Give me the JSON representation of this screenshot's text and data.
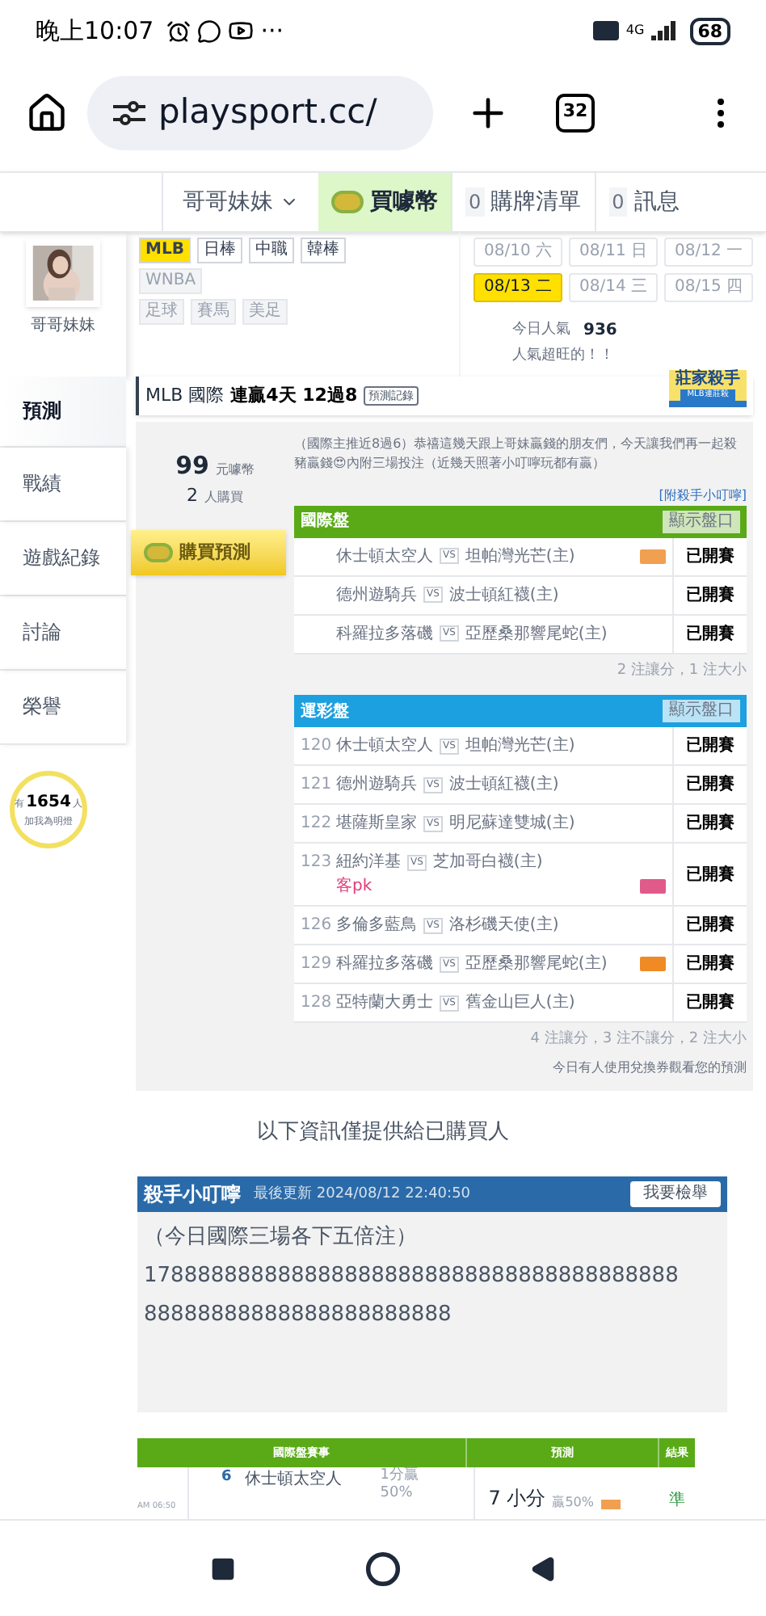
{
  "status_bar": {
    "time": "晚上10:07",
    "more": "···",
    "network": "4G",
    "battery": "68"
  },
  "browser": {
    "url": "playsport.cc/",
    "tab_count": "32"
  },
  "site_nav": {
    "user": "哥哥妹妹",
    "buy_coins": "買噱幣",
    "cart_count": "0",
    "cart": "購牌清單",
    "msg_count": "0",
    "messages": "訊息"
  },
  "profile": {
    "name": "哥哥妹妹"
  },
  "sports": [
    {
      "label": "MLB",
      "selected": true,
      "disabled": false
    },
    {
      "label": "日棒",
      "selected": false,
      "disabled": false
    },
    {
      "label": "中職",
      "selected": false,
      "disabled": false
    },
    {
      "label": "韓棒",
      "selected": false,
      "disabled": false
    },
    {
      "label": "WNBA",
      "selected": false,
      "disabled": true
    },
    {
      "label": "足球",
      "selected": false,
      "disabled": true
    },
    {
      "label": "賽馬",
      "selected": false,
      "disabled": true
    },
    {
      "label": "美足",
      "selected": false,
      "disabled": true
    }
  ],
  "dates": [
    {
      "date": "08/10",
      "day": "六",
      "selected": false
    },
    {
      "date": "08/11",
      "day": "日",
      "selected": false
    },
    {
      "date": "08/12",
      "day": "一",
      "selected": false
    },
    {
      "date": "08/13",
      "day": "二",
      "selected": true
    },
    {
      "date": "08/14",
      "day": "三",
      "selected": false
    },
    {
      "date": "08/15",
      "day": "四",
      "selected": false
    }
  ],
  "popularity": {
    "label": "今日人氣",
    "value": "936",
    "note": "人氣超旺的！！"
  },
  "sidebar": {
    "items": [
      {
        "label": "預測",
        "selected": true
      },
      {
        "label": "戰績",
        "selected": false
      },
      {
        "label": "遊戲紀錄",
        "selected": false
      },
      {
        "label": "討論",
        "selected": false
      },
      {
        "label": "榮譽",
        "selected": false
      }
    ],
    "fans_prefix": "有",
    "fans": "1654",
    "fans_suffix": "人",
    "fans_note": "加我為明燈"
  },
  "prediction": {
    "title": "MLB 國際",
    "streak": "連贏4天 12過8",
    "record_button": "預測記錄",
    "badge_title": "莊家殺手",
    "badge_sub": "MLB連莊殺",
    "price": "99",
    "price_unit": "元噱幣",
    "buyers": "2",
    "buyers_unit": "人購買",
    "buy_button": "購買預測",
    "description": "（國際主推近8過6）恭禧這幾天跟上哥妹贏錢的朋友們，今天讓我們再一起殺豬贏錢😍內附三場投注（近幾天照著小叮嚀玩都有贏）",
    "tip_link": "[附殺手小叮嚀]",
    "tables": [
      {
        "kind": "intl",
        "title": "國際盤",
        "button": "顯示盤口",
        "summary": "2 注讓分，1 注大小",
        "rows": [
          {
            "away": "休士頓太空人",
            "vs": "VS",
            "home": "坦帕灣光芒(主)",
            "color": "#f0a050",
            "status": "已開賽"
          },
          {
            "away": "德州遊騎兵",
            "vs": "VS",
            "home": "波士頓紅襪(主)",
            "status": "已開賽"
          },
          {
            "away": "科羅拉多落磯",
            "vs": "VS",
            "home": "亞歷桑那響尾蛇(主)",
            "status": "已開賽"
          }
        ]
      },
      {
        "kind": "lottery",
        "title": "運彩盤",
        "button": "顯示盤口",
        "summary": "4 注讓分，3 注不讓分，2 注大小",
        "rows": [
          {
            "num": "120",
            "away": "休士頓太空人",
            "vs": "VS",
            "home": "坦帕灣光芒(主)",
            "status": "已開賽"
          },
          {
            "num": "121",
            "away": "德州遊騎兵",
            "vs": "VS",
            "home": "波士頓紅襪(主)",
            "status": "已開賽"
          },
          {
            "num": "122",
            "away": "堪薩斯皇家",
            "vs": "VS",
            "home": "明尼蘇達雙城(主)",
            "status": "已開賽"
          },
          {
            "num": "123",
            "away": "紐約洋基",
            "vs": "VS",
            "home": "芝加哥白襪(主)",
            "note": "客pk",
            "color": "#e05a8a",
            "status": "已開賽"
          },
          {
            "num": "126",
            "away": "多倫多藍鳥",
            "vs": "VS",
            "home": "洛杉磯天使(主)",
            "status": "已開賽"
          },
          {
            "num": "129",
            "away": "科羅拉多落磯",
            "vs": "VS",
            "home": "亞歷桑那響尾蛇(主)",
            "color": "#f08a24",
            "status": "已開賽"
          },
          {
            "num": "128",
            "away": "亞特蘭大勇士",
            "vs": "VS",
            "home": "舊金山巨人(主)",
            "status": "已開賽"
          }
        ]
      }
    ],
    "coupon_note": "今日有人使用兌換券觀看您的預測"
  },
  "notice": "以下資訊僅提供給已購買人",
  "tip": {
    "title": "殺手小叮嚀",
    "updated": "最後更新 2024/08/12 22:40:50",
    "report_button": "我要檢舉",
    "lines": [
      "（今日國際三場各下五倍注）",
      "1788888888888888888888888888888888888888",
      "88888888888888888888888"
    ]
  },
  "results": {
    "columns": [
      "國際盤賽事",
      "預測",
      "結果"
    ],
    "rows": [
      {
        "time": "AM 06:50",
        "num": "6",
        "team": "休士頓太空人",
        "line": "1分贏",
        "line_pct": "50%",
        "pick": "7 小分",
        "pick_pct": "贏50%",
        "result": "準"
      }
    ]
  }
}
